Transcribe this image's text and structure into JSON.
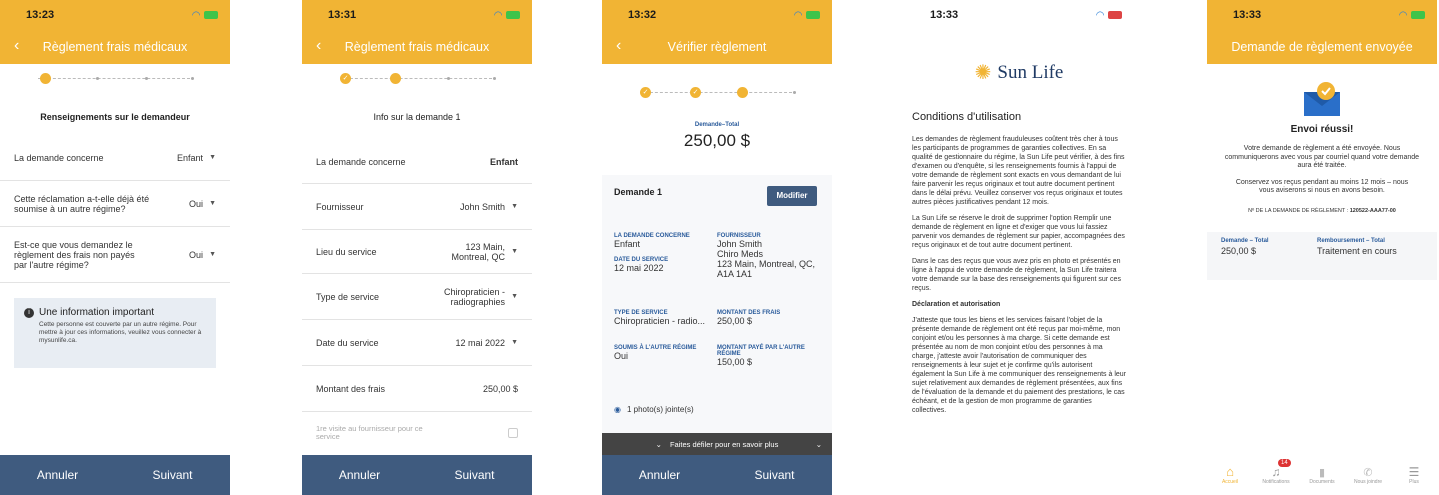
{
  "screen1": {
    "time": "13:23",
    "title": "Règlement frais médicaux",
    "section_title": "Renseignements sur le demandeur",
    "rows": [
      {
        "label": "La demande concerne",
        "value": "Enfant"
      },
      {
        "label": "Cette réclamation a-t-elle déjà été soumise à un autre régime?",
        "value": "Oui"
      },
      {
        "label": "Est-ce que vous demandez le règlement des frais non payés par l'autre régime?",
        "value": "Oui"
      }
    ],
    "info_title": "Une information important",
    "info_text": "Cette personne est couverte par un autre régime. Pour mettre à jour ces informations, veuillez vous connecter à mysunlife.ca.",
    "cancel": "Annuler",
    "next": "Suivant"
  },
  "screen2": {
    "time": "13:31",
    "title": "Règlement frais médicaux",
    "section_title": "Info sur la demande 1",
    "rows": [
      {
        "label": "La demande concerne",
        "value": "Enfant"
      },
      {
        "label": "Fournisseur",
        "value": "John Smith"
      },
      {
        "label": "Lieu du service",
        "value": "123 Main, Montreal, QC"
      },
      {
        "label": "Type de service",
        "value": "Chiropraticien - radiographies"
      },
      {
        "label": "Date du service",
        "value": "12 mai 2022"
      },
      {
        "label": "Montant des frais",
        "value": "250,00 $"
      }
    ],
    "checkbox_label": "1re visite au fournisseur pour ce service",
    "cancel": "Annuler",
    "next": "Suivant"
  },
  "screen3": {
    "time": "13:32",
    "title": "Vérifier règlement",
    "total_label": "Demande–Total",
    "total": "250,00 $",
    "claim_title": "Demande 1",
    "edit": "Modifier",
    "fields": {
      "concerns_label": "LA DEMANDE CONCERNE",
      "concerns": "Enfant",
      "provider_label": "FOURNISSEUR",
      "provider": "John Smith\nChiro Meds\n123 Main, Montreal, QC, A1A 1A1",
      "date_label": "DATE DU SERVICE",
      "date": "12 mai 2022",
      "type_label": "TYPE DE SERVICE",
      "type": "Chiropraticien - radio...",
      "amount_label": "MONTANT DES FRAIS",
      "amount": "250,00 $",
      "other_label": "SOUMIS À L'AUTRE RÉGIME",
      "other": "Oui",
      "paid_label": "MONTANT PAYÉ PAR L'AUTRE RÉGIME",
      "paid": "150,00 $"
    },
    "photos": "1 photo(s) jointe(s)",
    "scroll_hint": "Faites défiler pour en savoir plus",
    "cancel": "Annuler",
    "next": "Suivant"
  },
  "screen4": {
    "time": "13:33",
    "logo": "Sun Life",
    "title": "Conditions d'utilisation",
    "p1": "Les demandes de règlement frauduleuses coûtent très cher à tous les participants de programmes de garanties collectives. En sa qualité de gestionnaire du régime, la Sun Life peut vérifier, à des fins d'examen ou d'enquête, si les renseignements fournis à l'appui de votre demande de règlement sont exacts en vous demandant de lui faire parvenir les reçus originaux et tout autre document pertinent dans le délai prévu. Veuillez conserver vos reçus originaux et toutes autres pièces justificatives pendant 12 mois.",
    "p2": "La Sun Life se réserve le droit de supprimer l'option Remplir une demande de règlement en ligne et d'exiger que vous lui fassiez parvenir vos demandes de règlement sur papier, accompagnées des reçus originaux et de tout autre document pertinent.",
    "p3": "Dans le cas des reçus que vous avez pris en photo et présentés en ligne à l'appui de votre demande de règlement, la Sun Life traitera votre demande sur la base des renseignements qui figurent sur ces reçus.",
    "subtitle": "Déclaration et autorisation",
    "p4": "J'atteste que tous les biens et les services faisant l'objet de la présente demande de règlement ont été reçus par moi-même, mon conjoint et/ou les personnes à ma charge. Si cette demande est présentée au nom de mon conjoint et/ou des personnes à ma charge, j'atteste avoir l'autorisation de communiquer des renseignements à leur sujet et je confirme qu'ils autorisent également la Sun Life à me communiquer des renseignements à leur sujet relativement aux demandes de règlement présentées, aux fins de l'évaluation de la demande et du paiement des prestations, le cas échéant, et de la gestion de mon programme de garanties collectives."
  },
  "screen5": {
    "time": "13:33",
    "title": "Demande de règlement envoyée",
    "success": "Envoi réussi!",
    "msg1": "Votre demande de règlement a été envoyée. Nous communiquerons avec vous par courriel quand votre demande aura été traitée.",
    "msg2": "Conservez vos reçus pendant au moins 12 mois – nous vous aviserons si nous en avons besoin.",
    "ref_label": "Nº DE LA DEMANDE DE RÈGLEMENT :",
    "ref": "120522-AAA77-00",
    "total_label": "Demande – Total",
    "total": "250,00 $",
    "reimb_label": "Remboursement – Total",
    "reimb": "Traitement en cours",
    "tabs": [
      {
        "label": "Accueil",
        "icon": "home-icon"
      },
      {
        "label": "Notifications",
        "icon": "bell-icon",
        "badge": "14"
      },
      {
        "label": "Documents",
        "icon": "document-icon"
      },
      {
        "label": "Nous joindre",
        "icon": "phone-icon"
      },
      {
        "label": "Plus",
        "icon": "menu-icon"
      }
    ]
  }
}
